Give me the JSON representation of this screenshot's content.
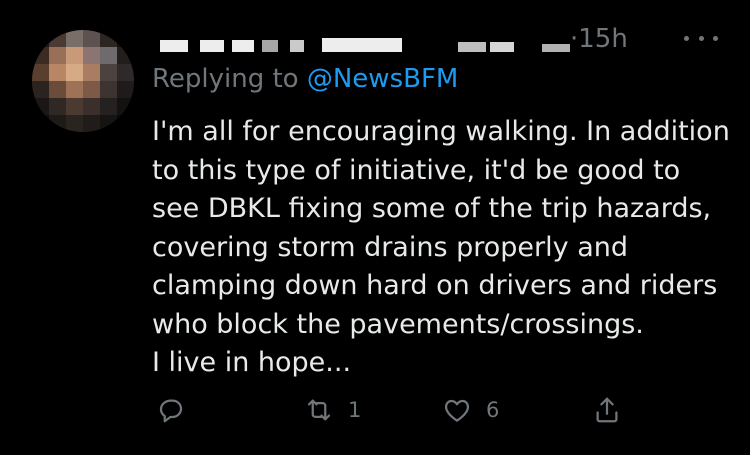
{
  "tweet": {
    "timestamp": "15h",
    "replying_prefix": "Replying to ",
    "reply_handle": "@NewsBFM",
    "text": "I'm all for encouraging walking. In addition\nto this type of initiative, it'd be good to\nsee DBKL fixing some of the trip hazards,\ncovering storm drains properly and\nclamping down hard on drivers and riders\nwho block the pavements/crossings.\nI live in hope...",
    "actions": {
      "reply_icon": "reply-icon",
      "retweet_icon": "retweet-icon",
      "retweet_count": "1",
      "like_icon": "heart-icon",
      "like_count": "6",
      "share_icon": "share-icon"
    }
  },
  "colors": {
    "background": "#000000",
    "text": "#e7e9ea",
    "muted": "#71767b",
    "link": "#1d9bf0"
  }
}
